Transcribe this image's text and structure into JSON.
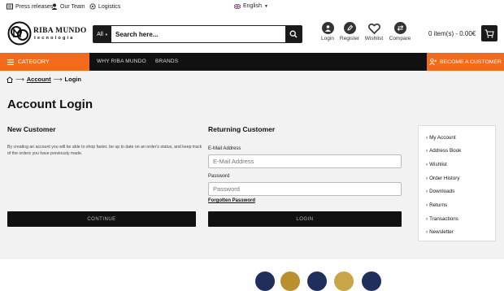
{
  "topbar": {
    "press_releases": "Press releases",
    "our_team": "Our Team",
    "logistics": "Logistics",
    "language": "English"
  },
  "header": {
    "logo_line1": "RIBA MUNDO",
    "logo_line2": "tecnologia",
    "search_category": "All",
    "search_placeholder": "Search here...",
    "icons": [
      {
        "label": "Login",
        "icon": "user-icon"
      },
      {
        "label": "Register",
        "icon": "pencil-icon"
      },
      {
        "label": "Wishlist",
        "icon": "heart-icon"
      },
      {
        "label": "Compare",
        "icon": "compare-icon"
      }
    ],
    "cart_text": "0 item(s) - 0.00€"
  },
  "nav": {
    "category": "CATEGORY",
    "links": [
      "WHY RIBA MUNDO",
      "BRANDS"
    ],
    "become_customer": "BECOME A CUSTOMER"
  },
  "breadcrumb": {
    "items": [
      "Account",
      "Login"
    ]
  },
  "page": {
    "title": "Account Login",
    "new_customer": {
      "heading": "New Customer",
      "text": "By creating an account you will be able to shop faster, be up to date on an order's status, and keep track of the orders you have previously made.",
      "button": "CONTINUE"
    },
    "returning_customer": {
      "heading": "Returning Customer",
      "email_label": "E-Mail Address",
      "email_placeholder": "E-Mail Address",
      "password_label": "Password",
      "password_placeholder": "Password",
      "forgot": "Forgotten Password",
      "button": "LOGIN"
    }
  },
  "sidebar": {
    "items": [
      "My Account",
      "Address Book",
      "Wishlist",
      "Order History",
      "Downloads",
      "Returns",
      "Transactions",
      "Newsletter"
    ]
  },
  "colors": {
    "accent": "#f26a1b",
    "dark": "#111111",
    "background": "#f2f2f2"
  }
}
